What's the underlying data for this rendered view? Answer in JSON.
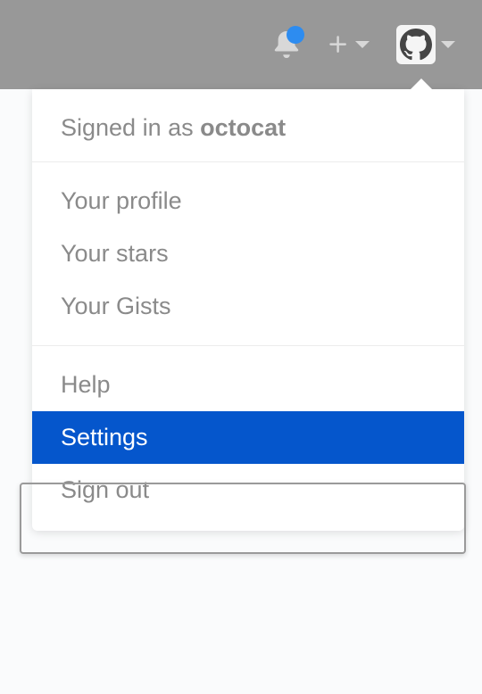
{
  "header": {
    "notification_icon": "bell-icon",
    "add_menu_icon": "plus-icon",
    "avatar_icon": "octocat-avatar"
  },
  "dropdown": {
    "signed_in_prefix": "Signed in as ",
    "username": "octocat",
    "section1": {
      "profile": "Your profile",
      "stars": "Your stars",
      "gists": "Your Gists"
    },
    "section2": {
      "help": "Help",
      "settings": "Settings",
      "signout": "Sign out"
    },
    "selected": "settings"
  }
}
